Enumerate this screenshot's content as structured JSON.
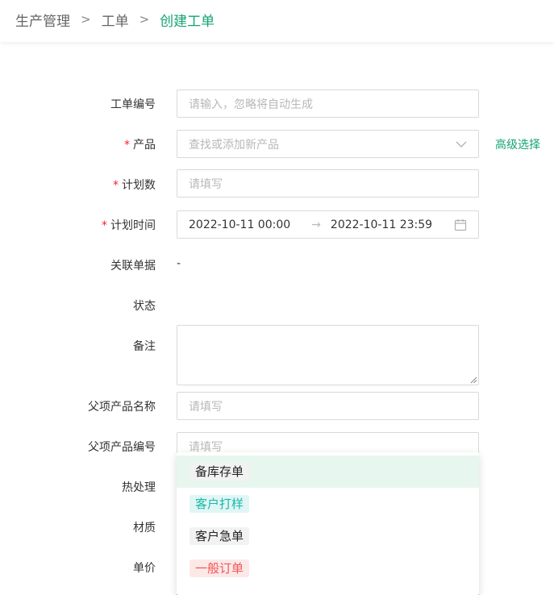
{
  "breadcrumb": {
    "items": [
      "生产管理",
      "工单",
      "创建工单"
    ],
    "separator": ">"
  },
  "form": {
    "work_order_no": {
      "label": "工单编号",
      "placeholder": "请输入，忽略将自动生成"
    },
    "product": {
      "label": "产品",
      "placeholder": "查找或添加新产品",
      "advanced_link": "高级选择",
      "required_mark": "*"
    },
    "plan_qty": {
      "label": "计划数",
      "placeholder": "请填写",
      "required_mark": "*"
    },
    "plan_time": {
      "label": "计划时间",
      "start": "2022-10-11 00:00",
      "arrow": "→",
      "end": "2022-10-11 23:59",
      "required_mark": "*"
    },
    "related_doc": {
      "label": "关联单据",
      "value": "-"
    },
    "status": {
      "label": "状态"
    },
    "remark": {
      "label": "备注"
    },
    "parent_name": {
      "label": "父项产品名称",
      "placeholder": "请填写"
    },
    "parent_code": {
      "label": "父项产品编号",
      "placeholder": "请填写"
    },
    "heat_treatment": {
      "label": "热处理"
    },
    "material": {
      "label": "材质"
    },
    "unit_price": {
      "label": "单价"
    }
  },
  "dropdown": {
    "options": [
      {
        "label": "备库存单",
        "style": "default",
        "hovered": true
      },
      {
        "label": "客户打样",
        "style": "cyan"
      },
      {
        "label": "客户急单",
        "style": "default"
      },
      {
        "label": "一般订单",
        "style": "red"
      }
    ]
  },
  "colors": {
    "accent": "#13a373",
    "required": "#f5222d",
    "border": "#d9d9d9",
    "placeholder": "#b8b8b8",
    "hover_bg": "#e8f6f0"
  },
  "icons": {
    "select_arrow": "chevron-down-icon",
    "calendar": "calendar-icon"
  }
}
